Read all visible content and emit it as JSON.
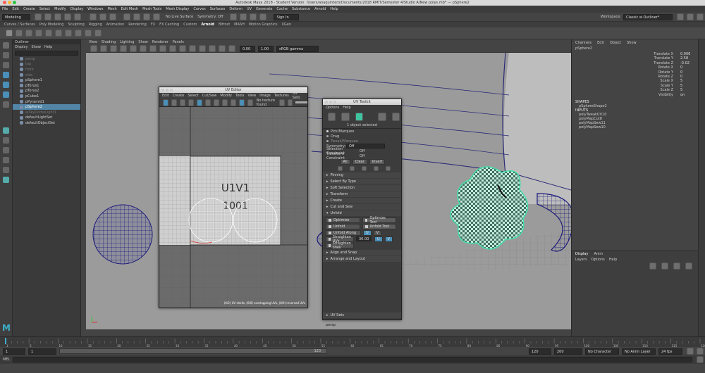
{
  "window": {
    "title": "Autodesk Maya 2018 - Student Version: /Users/anaquintero/Documents/2018 RMIT/Semester 4/Studio A/New polys.mb* --- pSphere2",
    "workspace_label": "Workspace:",
    "workspace_value": "Classic w Outliner*"
  },
  "menubar": [
    "File",
    "Edit",
    "Create",
    "Select",
    "Modify",
    "Display",
    "Windows",
    "Mesh",
    "Edit Mesh",
    "Mesh Tools",
    "Mesh Display",
    "Curves",
    "Surfaces",
    "Deform",
    "UV",
    "Generate",
    "Cache",
    "Substance",
    "Arnold",
    "Help"
  ],
  "statusline": {
    "mode": "Modeling",
    "live_surface": "No Live Surface",
    "symmetry": "Symmetry: Off",
    "sign_in": "Sign In"
  },
  "shelf_tabs": [
    "Curves / Surfaces",
    "Poly Modeling",
    "Sculpting",
    "Rigging",
    "Animation",
    "Rendering",
    "FX",
    "FX Caching",
    "Custom",
    "Arnold",
    "Bifrost",
    "MASH",
    "Motion Graphics",
    "XGen"
  ],
  "shelf_active": "Arnold",
  "outliner": {
    "title": "Outliner",
    "menu": [
      "Display",
      "Show",
      "Help"
    ],
    "items": [
      {
        "label": "persp",
        "state": "dim"
      },
      {
        "label": "top",
        "state": "dim"
      },
      {
        "label": "front",
        "state": "dim"
      },
      {
        "label": "side",
        "state": "dim"
      },
      {
        "label": "pSphere1",
        "state": "normal"
      },
      {
        "label": "pTorus1",
        "state": "normal"
      },
      {
        "label": "pTorus2",
        "state": "normal"
      },
      {
        "label": "pCube1",
        "state": "normal"
      },
      {
        "label": "pPyramid1",
        "state": "normal"
      },
      {
        "label": "pSphere2",
        "state": "selected"
      },
      {
        "label": "aiSkyDomeLight1",
        "state": "dim"
      },
      {
        "label": "defaultLightSet",
        "state": "normal"
      },
      {
        "label": "defaultObjectSet",
        "state": "normal"
      }
    ]
  },
  "viewport": {
    "menu": [
      "View",
      "Shading",
      "Lighting",
      "Show",
      "Renderer",
      "Panels"
    ],
    "exposure": "0.00",
    "gamma": "1.00",
    "color_space": "sRGB gamma",
    "mesh_label": "persp"
  },
  "channel_box": {
    "menu": [
      "Channels",
      "Edit",
      "Object",
      "Show"
    ],
    "object": "pSphere2",
    "attributes": [
      {
        "name": "Translate X",
        "value": "0.006"
      },
      {
        "name": "Translate Y",
        "value": "2.58"
      },
      {
        "name": "Translate Z",
        "value": "-0.02"
      },
      {
        "name": "Rotate X",
        "value": "0"
      },
      {
        "name": "Rotate Y",
        "value": "0"
      },
      {
        "name": "Rotate Z",
        "value": "0"
      },
      {
        "name": "Scale X",
        "value": "5"
      },
      {
        "name": "Scale Y",
        "value": "5"
      },
      {
        "name": "Scale Z",
        "value": "5"
      },
      {
        "name": "Visibility",
        "value": "on"
      }
    ],
    "shapes_header": "SHAPES",
    "shape": "pSphereShape2",
    "inputs_header": "INPUTS",
    "inputs": [
      "polyTweakUV10",
      "polyMapCut8",
      "polyMapSew11",
      "polyMapSew10"
    ]
  },
  "layer_editor": {
    "tabs": [
      "Display",
      "Anim"
    ],
    "menu": [
      "Layers",
      "Options",
      "Help"
    ]
  },
  "uv_editor": {
    "title": "UV Editor",
    "menu": [
      "Edit",
      "Create",
      "Select",
      "Cut/Sew",
      "Modify",
      "Tools",
      "View",
      "Image",
      "Textures",
      "UV Sets"
    ],
    "texture": "No texture found",
    "grid_label": "U1V1",
    "grid_sublabel": "1001",
    "status": "(0/2) UV shells, (0/0) overlapping UVs, (0/0) reversed UVs"
  },
  "uv_toolkit": {
    "title": "UV Toolkit",
    "menu": [
      "Options",
      "Help"
    ],
    "selection_info": "1 object selected",
    "pick_modes": [
      "Pick/Marquee",
      "Drag",
      "Tweak/Marquee"
    ],
    "symmetry_label": "Symmetry:",
    "symmetry_value": "Off",
    "selection_constraint_label": "Selection Constraint",
    "selection_constraint_value": "Off",
    "transform_constraint_label": "Transform Constraint",
    "transform_constraint_value": "Off",
    "buttons": [
      "All",
      "Clear",
      "Invert"
    ],
    "sections": [
      "Pinning",
      "Select By Type",
      "Soft Selection",
      "Transform",
      "Create",
      "Cut and Sew",
      "Unfold",
      "Align and Snap",
      "Arrange and Layout",
      "UV Sets"
    ],
    "unfold": {
      "optimize": "Optimize",
      "optimize_tool": "Optimize Tool",
      "unfold": "Unfold",
      "unfold_tool": "Unfold Tool",
      "unfold_along": "Unfold Along",
      "u": "U",
      "v": "V",
      "straighten_uvs": "Straighten UVs",
      "straighten_value": "30.00",
      "straighten_shell": "Straighten Shell"
    }
  },
  "timeslider": {
    "ticks": [
      "1",
      "5",
      "10",
      "15",
      "20",
      "25",
      "30",
      "35",
      "40",
      "45",
      "50",
      "55",
      "60",
      "65",
      "70",
      "75",
      "80",
      "85",
      "90",
      "95",
      "100",
      "105",
      "110",
      "115",
      "120"
    ],
    "current_frame": "1"
  },
  "range": {
    "start": "1",
    "inner_start": "1",
    "inner_end": "120",
    "end_a": "120",
    "end_b": "200",
    "character_set": "No Character Set",
    "anim_layer": "No Anim Layer",
    "fps": "24 fps"
  },
  "cmdline": {
    "label": "MEL"
  },
  "colors": {
    "accent": "#5285a6",
    "uv_wire": "#44e0a8",
    "mesh_blue": "#1a1a7a"
  }
}
